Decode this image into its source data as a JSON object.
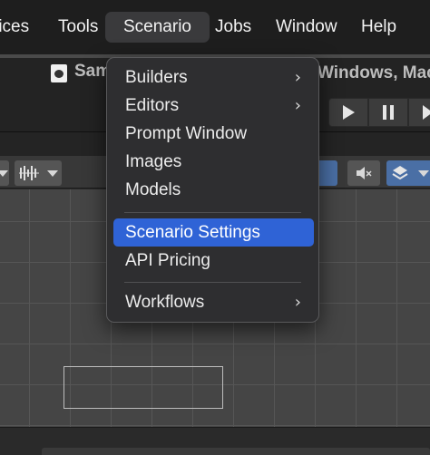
{
  "menubar": {
    "items": [
      "rices",
      "Tools",
      "Scenario",
      "Jobs",
      "Window",
      "Help"
    ],
    "active": "Scenario"
  },
  "window": {
    "title_left": "Sam",
    "title_right": "Windows, Mac"
  },
  "menu": {
    "items": [
      {
        "label": "Builders",
        "submenu": true
      },
      {
        "label": "Editors",
        "submenu": true
      },
      {
        "label": "Prompt Window",
        "submenu": false
      },
      {
        "label": "Images",
        "submenu": false
      },
      {
        "label": "Models",
        "submenu": false
      },
      {
        "label": "Scenario Settings",
        "submenu": false,
        "highlighted": true
      },
      {
        "label": "API Pricing",
        "submenu": false
      },
      {
        "label": "Workflows",
        "submenu": true
      }
    ],
    "submenu_glyph": "›"
  },
  "colors": {
    "highlight": "#2f63d6",
    "menu_bg": "#2e2e30",
    "menubar_bg": "#1e1e1e"
  }
}
